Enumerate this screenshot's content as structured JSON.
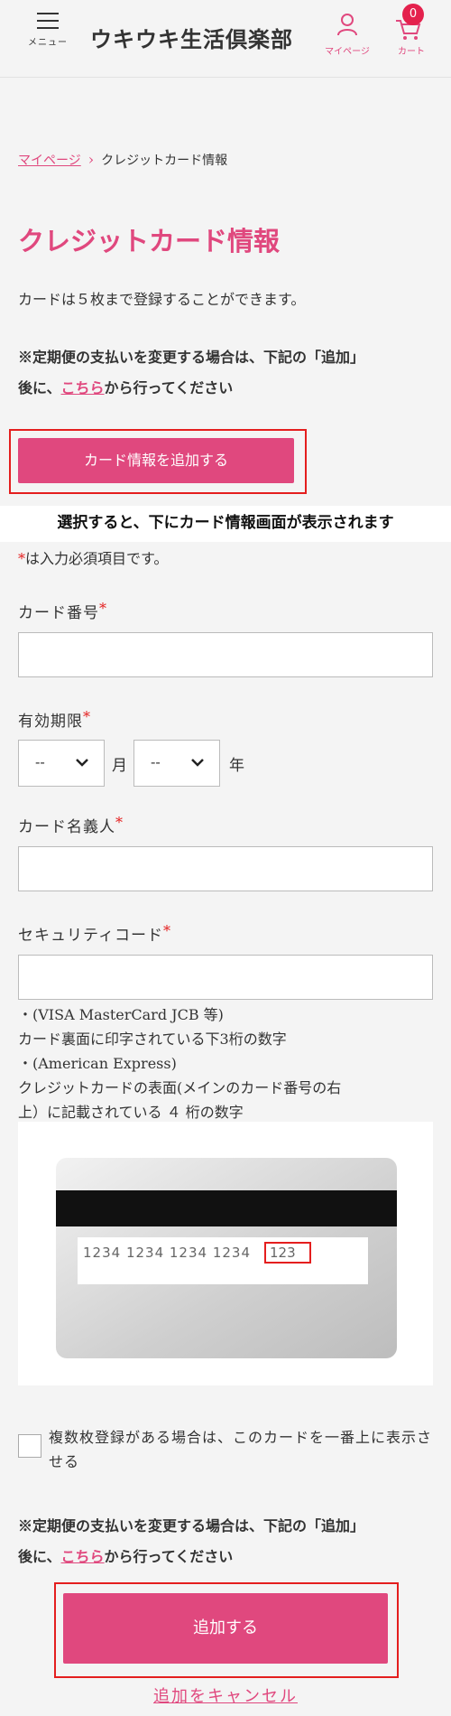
{
  "header": {
    "menu_label": "メニュー",
    "logo": "ウキウキ生活倶楽部",
    "mypage_label": "マイページ",
    "cart_label": "カート",
    "cart_count": "0"
  },
  "breadcrumb": {
    "parent": "マイページ",
    "current": "クレジットカード情報"
  },
  "page_title": "クレジットカード情報",
  "intro": "カードは５枚まで登録することができます。",
  "notice_top": {
    "line1": "※定期便の支払いを変更する場合は、下記の「追加」",
    "line2_pre": "後に、",
    "link": "こちら",
    "line2_post": "から行ってください"
  },
  "add_card_button": "カード情報を追加する",
  "banner": "選択すると、下にカード情報画面が表示されます",
  "required_note": {
    "mark": "*",
    "text": "は入力必須項目です。"
  },
  "fields": {
    "card_number": "カード番号",
    "expiry": "有効期限",
    "expiry_month_value": "--",
    "month_unit": "月",
    "expiry_year_value": "--",
    "year_unit": "年",
    "card_holder": "カード名義人",
    "security_code": "セキュリティコード",
    "required_mark": "*"
  },
  "security_note": [
    "・(VISA MasterCard JCB 等)",
    "カード裏面に印字されている下3桁の数字",
    "・(American Express)",
    "クレジットカードの表面(メインのカード番号の右",
    "上）に記載されている ４ 桁の数字"
  ],
  "card_image": {
    "number_groups": "1234 1234 1234 1234",
    "security_digits": "123"
  },
  "checkbox_label": "複数枚登録がある場合は、このカードを一番上に表示させる",
  "notice_bottom": {
    "line1": "※定期便の支払いを変更する場合は、下記の「追加」",
    "line2_pre": "後に、",
    "link": "こちら",
    "line2_post": "から行ってください"
  },
  "submit_button": "追加する",
  "cancel_link": "追加をキャンセル",
  "colors": {
    "accent": "#e0487e",
    "highlight": "#e41e1e",
    "background": "#f4f4f4"
  }
}
